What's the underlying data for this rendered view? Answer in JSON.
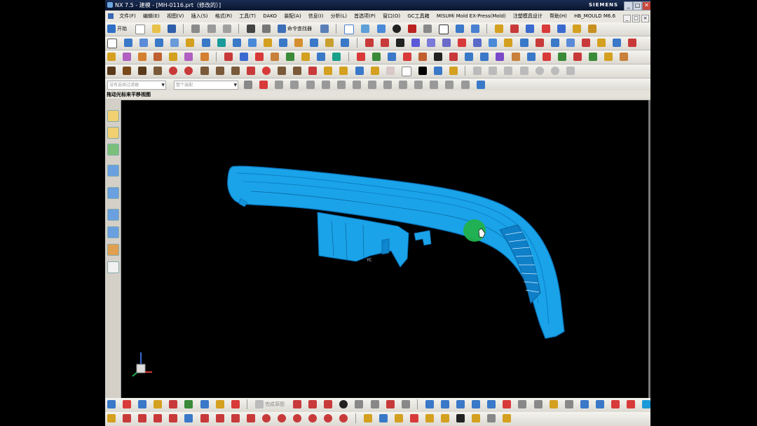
{
  "window": {
    "title": "NX 7.5 - 建模 - [MH-0116.prt（修改的）]",
    "brand": "SIEMENS",
    "controls": [
      "_",
      "□",
      "✕"
    ]
  },
  "menu": {
    "items": [
      "文件(F)",
      "编辑(E)",
      "视图(V)",
      "插入(S)",
      "格式(R)",
      "工具(T)",
      "DAKO",
      "装配(A)",
      "信息(I)",
      "分析(L)",
      "首选项(P)",
      "窗口(O)",
      "GC工具箱",
      "MISUMi Mold EX-Press(Mold)",
      "注塑模具设计",
      "帮助(H)",
      "HB_MOULD M6.6"
    ]
  },
  "toolbar1": {
    "start_label": "开始",
    "command_finder_label": "命令查找器"
  },
  "selection_bar": {
    "type_filter_placeholder": "没有选择过滤器",
    "scope_placeholder": "整个装配"
  },
  "status": {
    "cue_text": "拖动光标来平移视图"
  },
  "viewport": {
    "background_color": "#000000",
    "model_color": "#1aa3e8",
    "cursor_highlight_color": "#22b14c",
    "axis_label": "YC"
  },
  "bottom_toolbar": {
    "sketch_label": "完成草图"
  },
  "icons": {
    "left_resource_bar": [
      "assembly-navigator-icon",
      "constraint-navigator-icon",
      "part-navigator-icon",
      "reuse-library-icon",
      "web-browser-icon",
      "history-icon",
      "process-studio-icon",
      "roles-icon",
      "system-materials-icon"
    ]
  }
}
